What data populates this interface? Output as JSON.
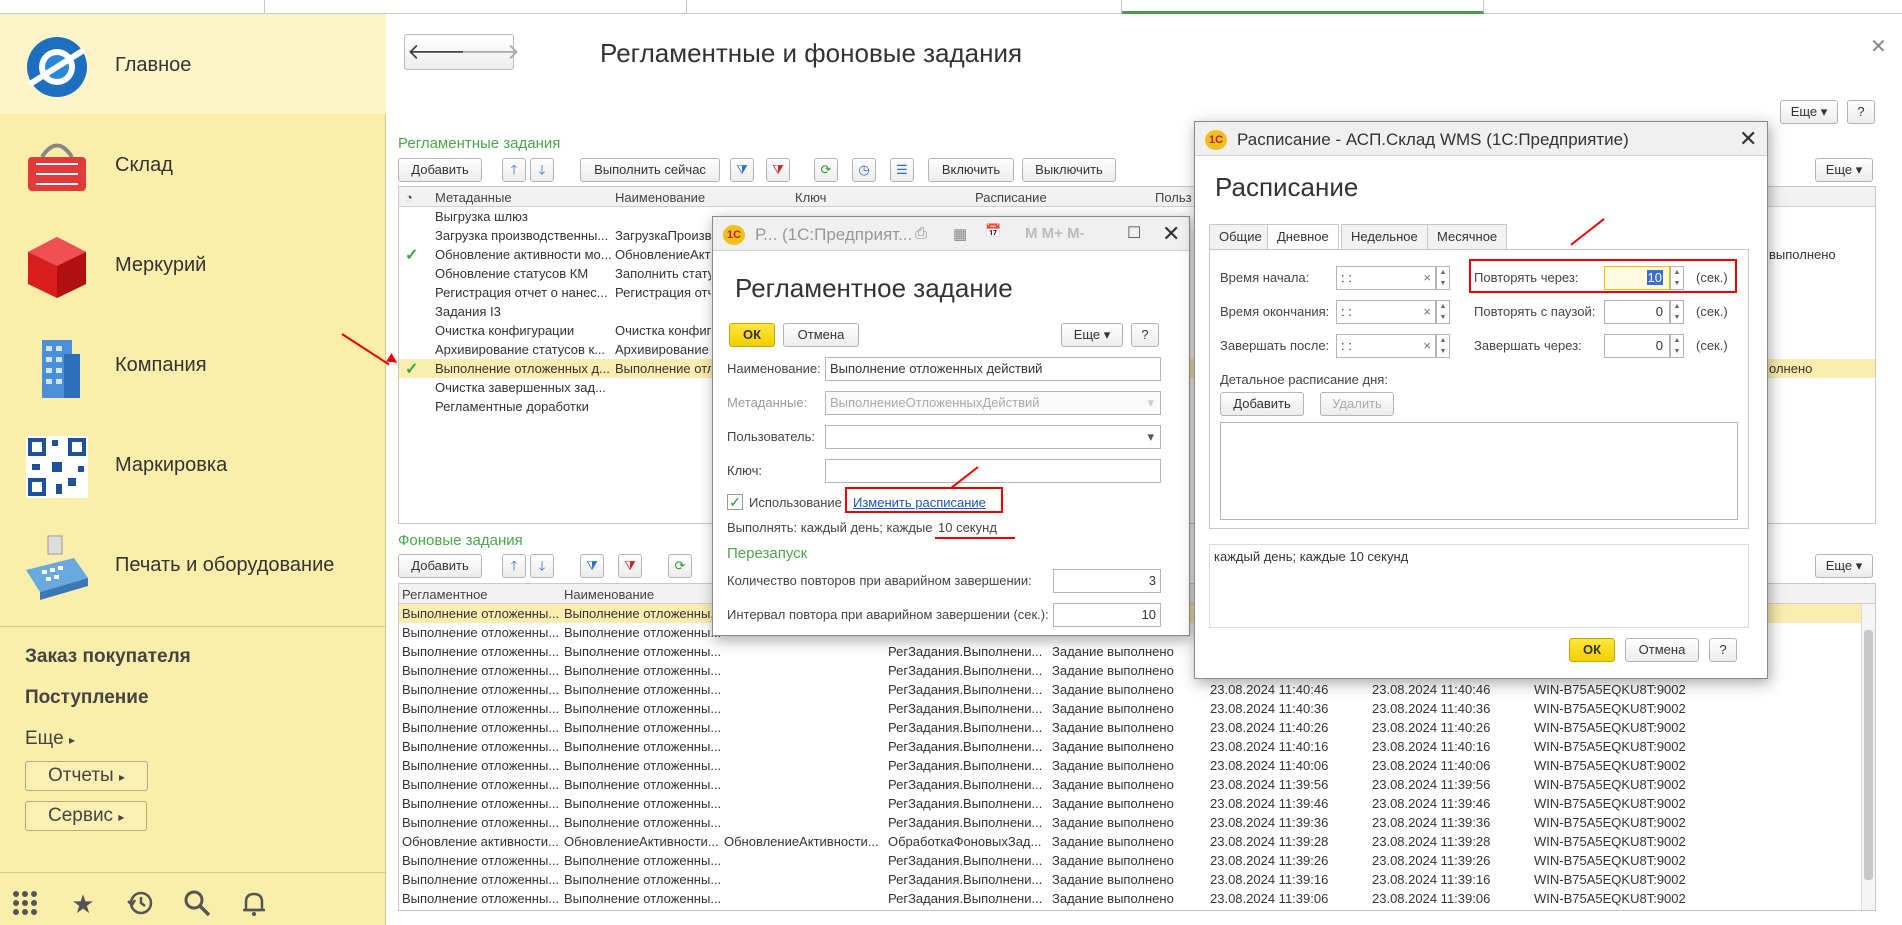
{
  "sidebar": {
    "items": [
      {
        "label": "Главное",
        "icon": "logo-icon"
      },
      {
        "label": "Склад",
        "icon": "basket-icon"
      },
      {
        "label": "Меркурий",
        "icon": "cube-icon"
      },
      {
        "label": "Компания",
        "icon": "building-icon"
      },
      {
        "label": "Маркировка",
        "icon": "qr-code-icon"
      },
      {
        "label": "Печать и оборудование",
        "icon": "cash-register-icon"
      }
    ],
    "links": [
      "Заказ покупателя",
      "Поступление"
    ],
    "more": "Еще",
    "buttons": [
      "Отчеты",
      "Сервис"
    ]
  },
  "page": {
    "title": "Регламентные и фоновые задания",
    "more": "Еще",
    "help": "?"
  },
  "scheduled": {
    "title": "Регламентные задания",
    "toolbar": {
      "add": "Добавить",
      "run_now": "Выполнить сейчас",
      "enable": "Включить",
      "disable": "Выключить",
      "more": "Еще"
    },
    "columns": [
      "Метаданные",
      "Наименование",
      "Ключ",
      "Расписание",
      "Польз"
    ],
    "rows": [
      {
        "check": "",
        "meta": "Выгрузка шлюз",
        "name": "",
        "right": ""
      },
      {
        "check": "",
        "meta": "Загрузка производственны...",
        "name": "ЗагрузкаПроизв",
        "right": ""
      },
      {
        "check": "✓",
        "meta": "Обновление активности мо...",
        "name": "ОбновлениеАкти",
        "right": "выполнено"
      },
      {
        "check": "",
        "meta": "Обновление статусов КМ",
        "name": "Заполнить стату",
        "right": ""
      },
      {
        "check": "",
        "meta": "Регистрация отчет о нанес...",
        "name": "Регистрация отч",
        "right": ""
      },
      {
        "check": "",
        "meta": "Задания I3",
        "name": "",
        "right": ""
      },
      {
        "check": "",
        "meta": "Очистка конфигурации",
        "name": "Очистка конфигу",
        "right": ""
      },
      {
        "check": "",
        "meta": "Архивирование статусов к...",
        "name": "Архивирование",
        "right": ""
      },
      {
        "check": "✓",
        "meta": "Выполнение отложенных д...",
        "name": "Выполнение отл",
        "right": "олнено"
      },
      {
        "check": "",
        "meta": "Очистка завершенных зад...",
        "name": "",
        "right": ""
      },
      {
        "check": "",
        "meta": "Регламентные доработки",
        "name": "",
        "right": ""
      }
    ]
  },
  "background": {
    "title": "Фоновые задания",
    "toolbar": {
      "add": "Добавить",
      "more": "Еще"
    },
    "columns": [
      "Регламентное",
      "Наименование"
    ],
    "rows": [
      {
        "a": "Выполнение отложенны...",
        "b": "Выполнение отложенны...",
        "c": "",
        "d": "",
        "e": "",
        "f": "",
        "g": "",
        "h": ""
      },
      {
        "a": "Выполнение отложенны...",
        "b": "Выполнение отложенны...",
        "c": "",
        "d": "",
        "e": "",
        "f": "",
        "g": "",
        "h": ""
      },
      {
        "a": "Выполнение отложенны...",
        "b": "Выполнение отложенны...",
        "c": "",
        "d": "РегЗадания.Выполнени...",
        "e": "Задание выполнено",
        "f": "",
        "g": "",
        "h": ""
      },
      {
        "a": "Выполнение отложенны...",
        "b": "Выполнение отложенны...",
        "c": "",
        "d": "РегЗадания.Выполнени...",
        "e": "Задание выполнено",
        "f": "",
        "g": "",
        "h": ""
      },
      {
        "a": "Выполнение отложенны...",
        "b": "Выполнение отложенны...",
        "c": "",
        "d": "РегЗадания.Выполнени...",
        "e": "Задание выполнено",
        "f": "23.08.2024 11:40:46",
        "g": "23.08.2024 11:40:46",
        "h": "WIN-B75A5EQKU8T:9002"
      },
      {
        "a": "Выполнение отложенны...",
        "b": "Выполнение отложенны...",
        "c": "",
        "d": "РегЗадания.Выполнени...",
        "e": "Задание выполнено",
        "f": "23.08.2024 11:40:36",
        "g": "23.08.2024 11:40:36",
        "h": "WIN-B75A5EQKU8T:9002"
      },
      {
        "a": "Выполнение отложенны...",
        "b": "Выполнение отложенны...",
        "c": "",
        "d": "РегЗадания.Выполнени...",
        "e": "Задание выполнено",
        "f": "23.08.2024 11:40:26",
        "g": "23.08.2024 11:40:26",
        "h": "WIN-B75A5EQKU8T:9002"
      },
      {
        "a": "Выполнение отложенны...",
        "b": "Выполнение отложенны...",
        "c": "",
        "d": "РегЗадания.Выполнени...",
        "e": "Задание выполнено",
        "f": "23.08.2024 11:40:16",
        "g": "23.08.2024 11:40:16",
        "h": "WIN-B75A5EQKU8T:9002"
      },
      {
        "a": "Выполнение отложенны...",
        "b": "Выполнение отложенны...",
        "c": "",
        "d": "РегЗадания.Выполнени...",
        "e": "Задание выполнено",
        "f": "23.08.2024 11:40:06",
        "g": "23.08.2024 11:40:06",
        "h": "WIN-B75A5EQKU8T:9002"
      },
      {
        "a": "Выполнение отложенны...",
        "b": "Выполнение отложенны...",
        "c": "",
        "d": "РегЗадания.Выполнени...",
        "e": "Задание выполнено",
        "f": "23.08.2024 11:39:56",
        "g": "23.08.2024 11:39:56",
        "h": "WIN-B75A5EQKU8T:9002"
      },
      {
        "a": "Выполнение отложенны...",
        "b": "Выполнение отложенны...",
        "c": "",
        "d": "РегЗадания.Выполнени...",
        "e": "Задание выполнено",
        "f": "23.08.2024 11:39:46",
        "g": "23.08.2024 11:39:46",
        "h": "WIN-B75A5EQKU8T:9002"
      },
      {
        "a": "Выполнение отложенны...",
        "b": "Выполнение отложенны...",
        "c": "",
        "d": "РегЗадания.Выполнени...",
        "e": "Задание выполнено",
        "f": "23.08.2024 11:39:36",
        "g": "23.08.2024 11:39:36",
        "h": "WIN-B75A5EQKU8T:9002"
      },
      {
        "a": "Обновление активности...",
        "b": "ОбновлениеАктивности...",
        "c": "ОбновлениеАктивности...",
        "d": "ОбработкаФоновыхЗад...",
        "e": "Задание выполнено",
        "f": "23.08.2024 11:39:28",
        "g": "23.08.2024 11:39:28",
        "h": "WIN-B75A5EQKU8T:9002"
      },
      {
        "a": "Выполнение отложенны...",
        "b": "Выполнение отложенны...",
        "c": "",
        "d": "РегЗадания.Выполнени...",
        "e": "Задание выполнено",
        "f": "23.08.2024 11:39:26",
        "g": "23.08.2024 11:39:26",
        "h": "WIN-B75A5EQKU8T:9002"
      },
      {
        "a": "Выполнение отложенны...",
        "b": "Выполнение отложенны...",
        "c": "",
        "d": "РегЗадания.Выполнени...",
        "e": "Задание выполнено",
        "f": "23.08.2024 11:39:16",
        "g": "23.08.2024 11:39:16",
        "h": "WIN-B75A5EQKU8T:9002"
      },
      {
        "a": "Выполнение отложенны...",
        "b": "Выполнение отложенны...",
        "c": "",
        "d": "РегЗадания.Выполнени...",
        "e": "Задание выполнено",
        "f": "23.08.2024 11:39:06",
        "g": "23.08.2024 11:39:06",
        "h": "WIN-B75A5EQKU8T:9002"
      }
    ]
  },
  "task_dialog": {
    "window_title": "Р... (1С:Предприят...",
    "heading": "Регламентное задание",
    "ok": "ОК",
    "cancel": "Отмена",
    "more": "Еще",
    "help": "?",
    "name_label": "Наименование:",
    "name_value": "Выполнение отложенных действий",
    "meta_label": "Метаданные:",
    "meta_value": "ВыполнениеОтложенныхДействий",
    "user_label": "Пользователь:",
    "user_value": "",
    "key_label": "Ключ:",
    "key_value": "",
    "use_label": "Использование",
    "change_schedule": "Изменить расписание",
    "run_label": "Выполнять: каждый день; каждые",
    "run_value": "10 секунд",
    "restart_title": "Перезапуск",
    "retry_count_label": "Количество повторов при аварийном завершении:",
    "retry_count": "3",
    "retry_interval_label": "Интервал повтора при аварийном завершении (сек.):",
    "retry_interval": "10"
  },
  "schedule_dialog": {
    "window_title": "Расписание - АСП.Склад WMS  (1С:Предприятие)",
    "heading": "Расписание",
    "tabs": [
      "Общие",
      "Дневное",
      "Недельное",
      "Месячное"
    ],
    "active_tab": "Дневное",
    "start_label": "Время начала:",
    "end_label": "Время окончания:",
    "finish_after_label": "Завершать после:",
    "time_placeholder": " :  :",
    "repeat_label": "Повторять через:",
    "repeat_value": "10",
    "pause_label": "Повторять с паузой:",
    "pause_value": "0",
    "finish_in_label": "Завершать через:",
    "finish_in_value": "0",
    "unit": "(сек.)",
    "detail_label": "Детальное расписание дня:",
    "add": "Добавить",
    "delete": "Удалить",
    "summary": "каждый день; каждые 10 секунд",
    "ok": "ОК",
    "cancel": "Отмена",
    "help": "?"
  }
}
